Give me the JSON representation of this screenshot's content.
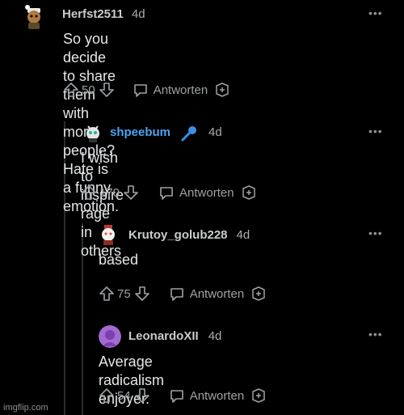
{
  "comments": [
    {
      "user": "Herfst2511",
      "time": "4d",
      "text_line1": "So you decide to share them with more",
      "text_line2": "people? Hate is a funny emotion.",
      "score": "50",
      "reply_label": "Antworten",
      "menu": "•••"
    },
    {
      "user": "shpeebum",
      "user_color": "#4aa3f0",
      "flair_icon": "microphone-icon",
      "time": "4d",
      "text": "I wish to inspire rage in others",
      "score": "170",
      "reply_label": "Antworten",
      "menu": "•••"
    },
    {
      "user": "Krutoy_golub228",
      "time": "4d",
      "text": "based",
      "score": "75",
      "reply_label": "Antworten",
      "menu": "•••"
    },
    {
      "user": "LeonardoXII",
      "time": "4d",
      "text": "Average radicalism enjoyer.",
      "score": "54",
      "reply_label": "Antworten",
      "menu": "•••"
    }
  ],
  "watermark": "imgflip.com"
}
